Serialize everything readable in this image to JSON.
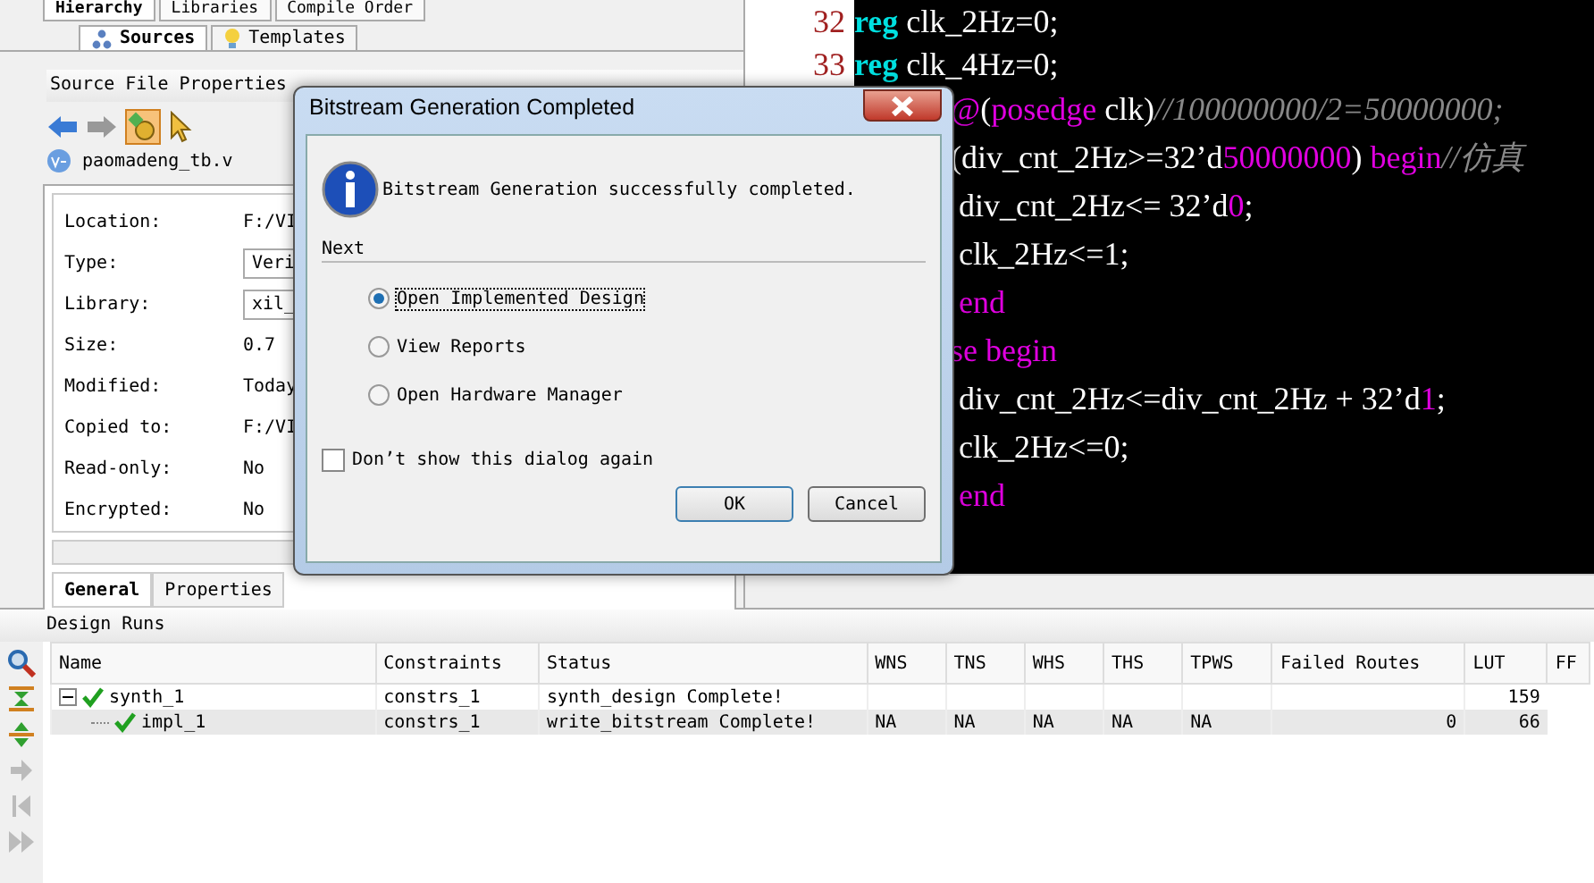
{
  "top_tabs": [
    {
      "label": "Hierarchy",
      "selected": true
    },
    {
      "label": "Libraries",
      "selected": false
    },
    {
      "label": "Compile Order",
      "selected": false
    }
  ],
  "source_tabs": [
    {
      "label": "Sources",
      "selected": true
    },
    {
      "label": "Templates",
      "selected": false
    }
  ],
  "properties_panel": {
    "title": "Source File Properties",
    "file": "paomadeng_tb.v",
    "rows": [
      {
        "label": "Location:",
        "value": "F:/VI",
        "kind": "text"
      },
      {
        "label": "Type:",
        "value": "Veri",
        "kind": "field"
      },
      {
        "label": "Library:",
        "value": "xil_",
        "kind": "field"
      },
      {
        "label": "Size:",
        "value": "0.7",
        "kind": "text"
      },
      {
        "label": "Modified:",
        "value": "Today",
        "kind": "text"
      },
      {
        "label": "Copied to:",
        "value": "F:/VI",
        "kind": "text"
      },
      {
        "label": "Read-only:",
        "value": "No",
        "kind": "text"
      },
      {
        "label": "Encrypted:",
        "value": "No",
        "kind": "text"
      }
    ],
    "tabs": [
      {
        "label": "General",
        "selected": true
      },
      {
        "label": "Properties",
        "selected": false
      }
    ]
  },
  "editor": {
    "numbered_lines": [
      {
        "number": "32",
        "tokens": [
          {
            "kind": "keyword",
            "text": "reg"
          },
          {
            "kind": "plain",
            "text": " clk_2Hz=0;"
          }
        ]
      },
      {
        "number": "33",
        "tokens": [
          {
            "kind": "keyword",
            "text": "reg"
          },
          {
            "kind": "plain",
            "text": " clk_4Hz=0;"
          }
        ]
      }
    ],
    "partial_lines": [
      {
        "tokens": [
          {
            "kind": "control",
            "text": "@"
          },
          {
            "kind": "plain",
            "text": "("
          },
          {
            "kind": "control",
            "text": "posedge"
          },
          {
            "kind": "plain",
            "text": " clk)"
          },
          {
            "kind": "comment",
            "text": "//100000000/2=50000000;"
          }
        ]
      },
      {
        "tokens": [
          {
            "kind": "plain",
            "text": "(div_cnt_2Hz>=32’d"
          },
          {
            "kind": "number",
            "text": "50000000"
          },
          {
            "kind": "plain",
            "text": ") "
          },
          {
            "kind": "control",
            "text": "begin"
          },
          {
            "kind": "comment",
            "text": "//仿真"
          }
        ]
      },
      {
        "tokens": [
          {
            "kind": "plain",
            "text": " div_cnt_2Hz<= 32’d"
          },
          {
            "kind": "number",
            "text": "0"
          },
          {
            "kind": "plain",
            "text": ";"
          }
        ]
      },
      {
        "tokens": [
          {
            "kind": "plain",
            "text": " clk_2Hz<=1;"
          }
        ]
      },
      {
        "tokens": [
          {
            "kind": "control",
            "text": " end"
          }
        ]
      },
      {
        "tokens": [
          {
            "kind": "control",
            "text": "se begin"
          }
        ]
      },
      {
        "tokens": [
          {
            "kind": "plain",
            "text": " div_cnt_2Hz<=div_cnt_2Hz + 32’d"
          },
          {
            "kind": "number",
            "text": "1"
          },
          {
            "kind": "plain",
            "text": ";"
          }
        ]
      },
      {
        "tokens": [
          {
            "kind": "plain",
            "text": " clk_2Hz<=0;"
          }
        ]
      },
      {
        "tokens": [
          {
            "kind": "control",
            "text": " end"
          }
        ]
      }
    ]
  },
  "design_runs": {
    "title": "Design Runs",
    "columns": [
      "Name",
      "Constraints",
      "Status",
      "WNS",
      "TNS",
      "WHS",
      "THS",
      "TPWS",
      "Failed Routes",
      "LUT",
      "FF"
    ],
    "rows": [
      {
        "expanded": true,
        "selected": false,
        "cells": [
          "synth_1",
          "constrs_1",
          "synth_design Complete!",
          "",
          "",
          "",
          "",
          "",
          "",
          "159"
        ],
        "children": [
          {
            "selected": true,
            "cells": [
              "impl_1",
              "constrs_1",
              "write_bitstream Complete!",
              "NA",
              "NA",
              "NA",
              "NA",
              "NA",
              "0",
              "66"
            ]
          }
        ]
      }
    ]
  },
  "dialog": {
    "title": "Bitstream Generation Completed",
    "message": "Bitstream Generation successfully completed.",
    "group_label": "Next",
    "options": [
      {
        "label": "Open Implemented Design",
        "selected": true
      },
      {
        "label": "View Reports",
        "selected": false
      },
      {
        "label": "Open Hardware Manager",
        "selected": false
      }
    ],
    "checkbox": {
      "label": "Don’t show this dialog again",
      "checked": false
    },
    "buttons": [
      "OK",
      "Cancel"
    ]
  }
}
